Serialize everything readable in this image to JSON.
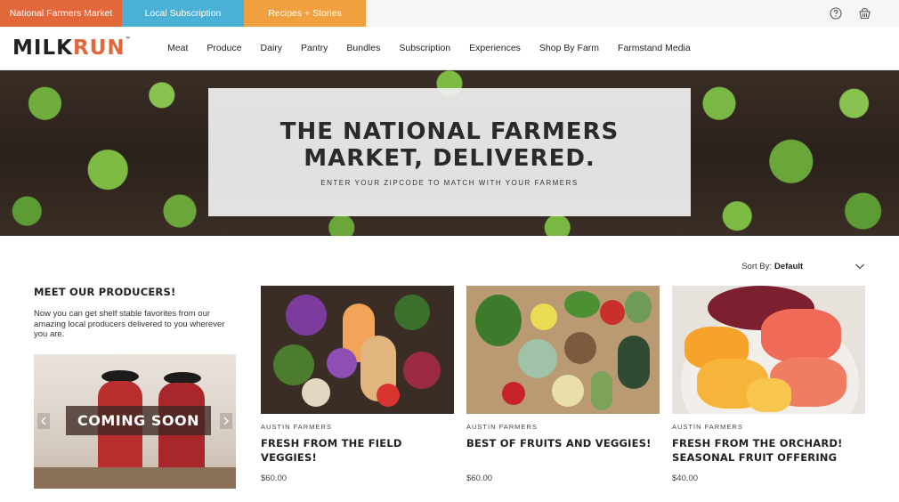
{
  "topbar": {
    "tabs": [
      {
        "label": "National Farmers Market",
        "color": "#e2683c"
      },
      {
        "label": "Local Subscription",
        "color": "#4ab0d6"
      },
      {
        "label": "Recipes + Stories",
        "color": "#f0a03e"
      }
    ],
    "icons": [
      "help-circle-icon",
      "basket-icon"
    ]
  },
  "nav": {
    "logo": {
      "part1": "MILK",
      "part2": "RUN",
      "mark": "™"
    },
    "items": [
      "Meat",
      "Produce",
      "Dairy",
      "Pantry",
      "Bundles",
      "Subscription",
      "Experiences",
      "Shop By Farm",
      "Farmstand Media"
    ]
  },
  "hero": {
    "title_line1": "The National Farmers",
    "title_line2": "Market, Delivered.",
    "subtitle": "Enter your zipcode to match with your farmers"
  },
  "sort": {
    "label": "Sort By:",
    "value": "Default"
  },
  "producers": {
    "title": "MEET OUR PRODUCERS!",
    "description": "Now you can get shelf stable favorites from our amazing local producers delivered to you wherever you are.",
    "badge": "COMING SOON"
  },
  "products": [
    {
      "farm": "Austin Farmers",
      "name": "Fresh from the field veggies!",
      "price": "$60.00"
    },
    {
      "farm": "Austin Farmers",
      "name": "Best of fruits and veggies!",
      "price": "$60.00"
    },
    {
      "farm": "Austin Farmers",
      "name": "Fresh from the orchard! Seasonal fruit offering",
      "price": "$40.00"
    }
  ],
  "colors": {
    "accent_orange": "#e2683c",
    "accent_blue": "#4ab0d6",
    "accent_yellow": "#f0a03e"
  }
}
